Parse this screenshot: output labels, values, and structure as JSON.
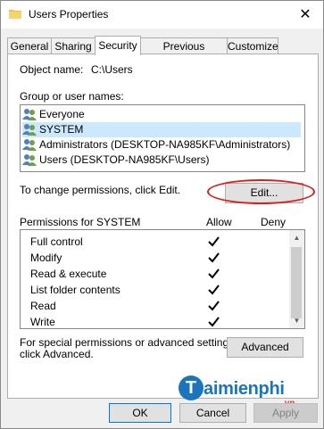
{
  "window": {
    "title": "Users Properties",
    "close_glyph": "✕"
  },
  "tabs": [
    {
      "label": "General"
    },
    {
      "label": "Sharing"
    },
    {
      "label": "Security"
    },
    {
      "label": "Previous Versions"
    },
    {
      "label": "Customize"
    }
  ],
  "security": {
    "object_name_label": "Object name:",
    "object_name_value": "C:\\Users",
    "groups_label": "Group or user names:",
    "groups": [
      {
        "name": "Everyone",
        "icon": "group-icon"
      },
      {
        "name": "SYSTEM",
        "icon": "group-icon",
        "selected": true
      },
      {
        "name": "Administrators (DESKTOP-NA985KF\\Administrators)",
        "icon": "group-icon"
      },
      {
        "name": "Users (DESKTOP-NA985KF\\Users)",
        "icon": "group-icon"
      }
    ],
    "change_text": "To change permissions, click Edit.",
    "edit_label": "Edit...",
    "permissions_label": "Permissions for SYSTEM",
    "allow_label": "Allow",
    "deny_label": "Deny",
    "permissions": [
      {
        "name": "Full control",
        "allow": true,
        "deny": false
      },
      {
        "name": "Modify",
        "allow": true,
        "deny": false
      },
      {
        "name": "Read & execute",
        "allow": true,
        "deny": false
      },
      {
        "name": "List folder contents",
        "allow": true,
        "deny": false
      },
      {
        "name": "Read",
        "allow": true,
        "deny": false
      },
      {
        "name": "Write",
        "allow": true,
        "deny": false
      }
    ],
    "special_text_line1": "For special permissions or advanced settings,",
    "special_text_line2": "click Advanced.",
    "advanced_label": "Advanced"
  },
  "buttons": {
    "ok": "OK",
    "cancel": "Cancel",
    "apply": "Apply"
  },
  "watermark": {
    "brand_initial": "T",
    "brand_rest": "aimienphi",
    "tld": ".vn"
  },
  "colors": {
    "selection": "#cce8ff",
    "highlight_oval": "#d81e1e",
    "accent": "#0078d7",
    "watermark": "#1b75bc"
  }
}
